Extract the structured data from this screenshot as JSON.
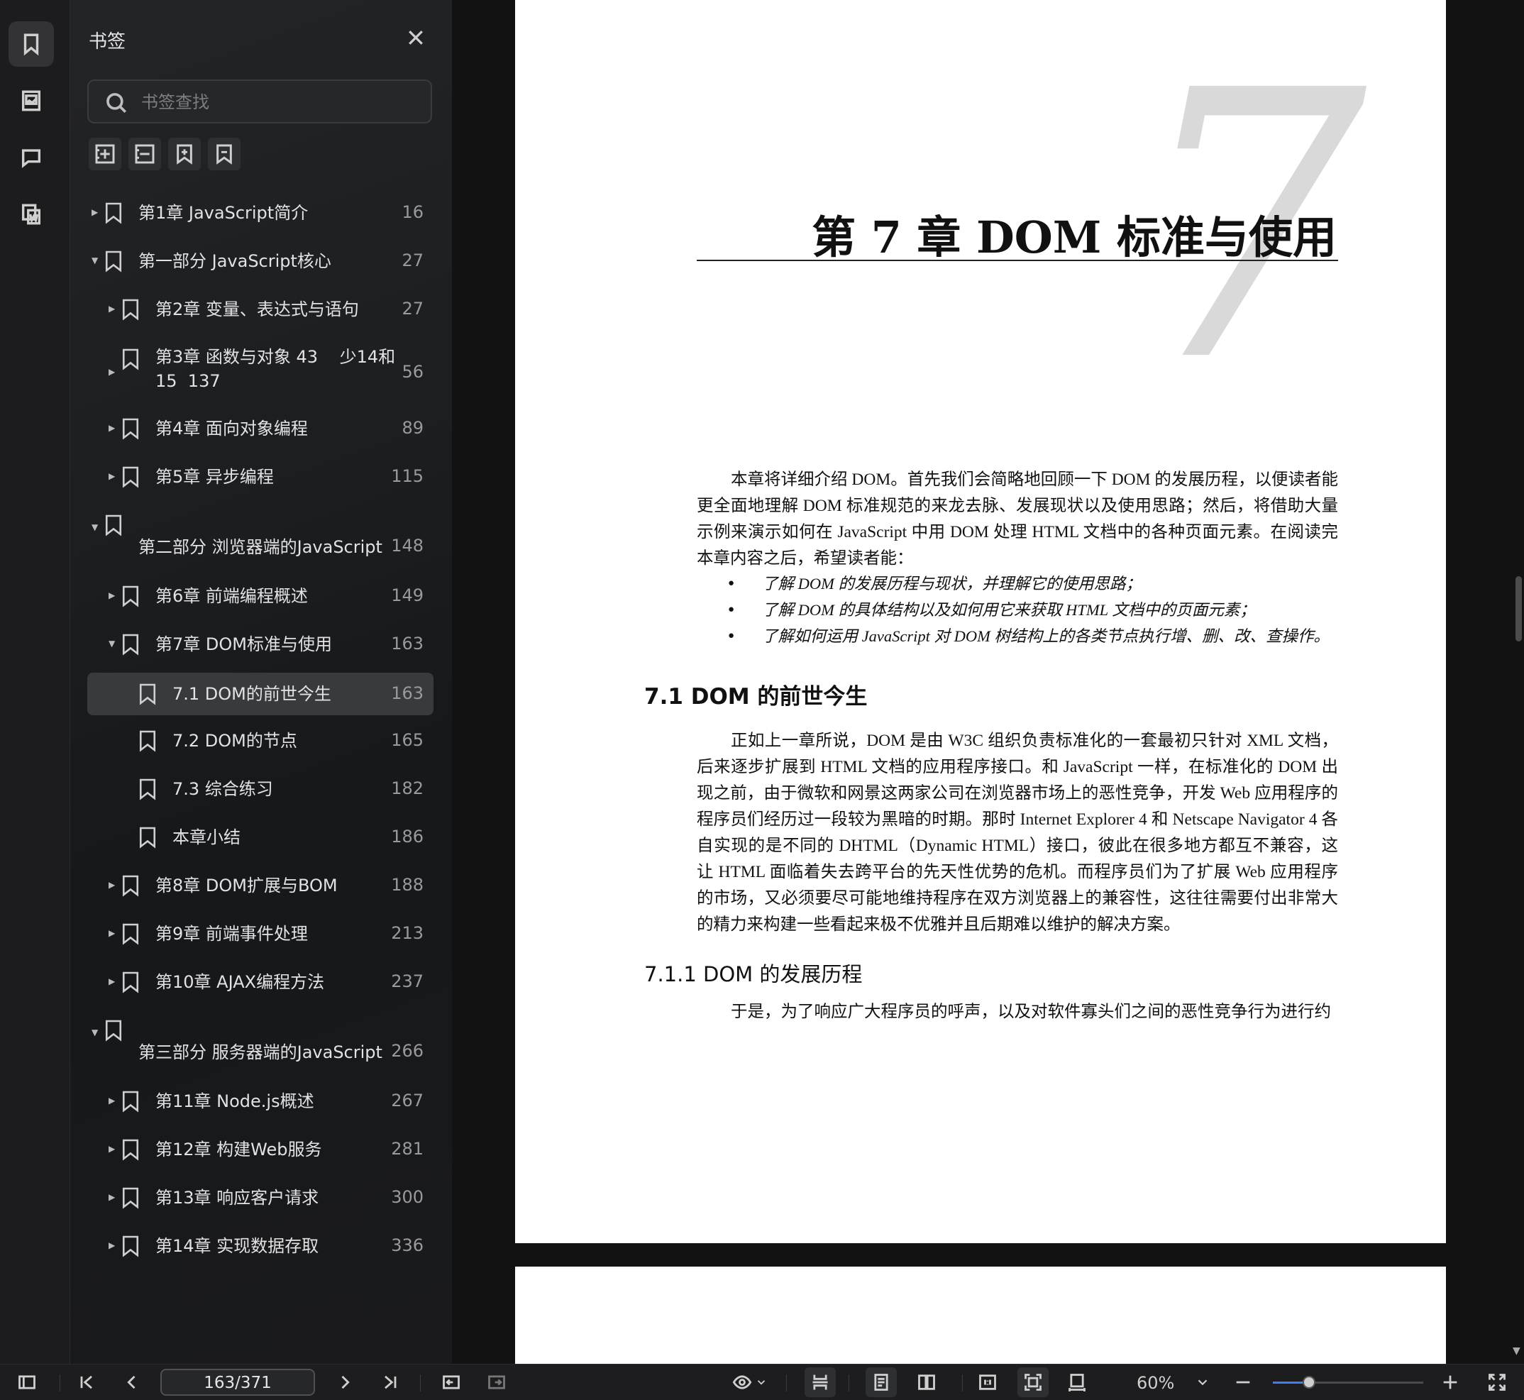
{
  "panel": {
    "title": "书签",
    "search_placeholder": "书签查找"
  },
  "bookmarks": [
    {
      "label": "第1章 JavaScript简介",
      "page": "16",
      "level": 0,
      "caret": "right"
    },
    {
      "label": "第一部分 JavaScript核心",
      "page": "27",
      "level": 0,
      "caret": "down"
    },
    {
      "label": "第2章 变量、表达式与语句",
      "page": "27",
      "level": 1,
      "caret": "right"
    },
    {
      "label": "第3章 函数与对象 43    少14和\n15  137",
      "page": "56",
      "level": 1,
      "caret": "right"
    },
    {
      "label": "第4章 面向对象编程",
      "page": "89",
      "level": 1,
      "caret": "right"
    },
    {
      "label": "第5章 异步编程",
      "page": "115",
      "level": 1,
      "caret": "right"
    },
    {
      "label": "第二部分 浏览器端的JavaScript",
      "page": "148",
      "level": 0,
      "caret": "down"
    },
    {
      "label": "第6章 前端编程概述",
      "page": "149",
      "level": 1,
      "caret": "right"
    },
    {
      "label": "第7章 DOM标准与使用",
      "page": "163",
      "level": 1,
      "caret": "down"
    },
    {
      "label": "7.1 DOM的前世今生",
      "page": "163",
      "level": 2,
      "caret": "",
      "selected": true
    },
    {
      "label": "7.2 DOM的节点",
      "page": "165",
      "level": 2,
      "caret": ""
    },
    {
      "label": "7.3 综合练习",
      "page": "182",
      "level": 2,
      "caret": ""
    },
    {
      "label": "本章小结",
      "page": "186",
      "level": 2,
      "caret": ""
    },
    {
      "label": "第8章 DOM扩展与BOM",
      "page": "188",
      "level": 1,
      "caret": "right"
    },
    {
      "label": "第9章 前端事件处理",
      "page": "213",
      "level": 1,
      "caret": "right"
    },
    {
      "label": "第10章 AJAX编程方法",
      "page": "237",
      "level": 1,
      "caret": "right"
    },
    {
      "label": "第三部分 服务器端的JavaScript",
      "page": "266",
      "level": 0,
      "caret": "down"
    },
    {
      "label": "第11章 Node.js概述",
      "page": "267",
      "level": 1,
      "caret": "right"
    },
    {
      "label": "第12章 构建Web服务",
      "page": "281",
      "level": 1,
      "caret": "right"
    },
    {
      "label": "第13章 响应客户请求",
      "page": "300",
      "level": 1,
      "caret": "right"
    },
    {
      "label": "第14章 实现数据存取",
      "page": "336",
      "level": 1,
      "caret": "right"
    }
  ],
  "document": {
    "chapter_number": "7",
    "chapter_title": "第 7 章    DOM 标准与使用",
    "intro": "本章将详细介绍 DOM。首先我们会简略地回顾一下 DOM 的发展历程，以便读者能更全面地理解 DOM 标准规范的来龙去脉、发展现状以及使用思路；然后，将借助大量示例来演示如何在 JavaScript 中用 DOM 处理 HTML 文档中的各种页面元素。在阅读完本章内容之后，希望读者能：",
    "bullets": [
      "了解 DOM 的发展历程与现状，并理解它的使用思路；",
      "了解 DOM 的具体结构以及如何用它来获取 HTML 文档中的页面元素；",
      "了解如何运用 JavaScript 对 DOM 树结构上的各类节点执行增、删、改、查操作。"
    ],
    "section_heading": "7.1    DOM 的前世今生",
    "section_para": "正如上一章所说，DOM 是由 W3C 组织负责标准化的一套最初只针对 XML 文档，后来逐步扩展到 HTML 文档的应用程序接口。和 JavaScript 一样，在标准化的 DOM 出现之前，由于微软和网景这两家公司在浏览器市场上的恶性竞争，开发 Web 应用程序的程序员们经历过一段较为黑暗的时期。那时 Internet Explorer 4 和 Netscape Navigator 4 各自实现的是不同的 DHTML（Dynamic HTML）接口，彼此在很多地方都互不兼容，这让 HTML 面临着失去跨平台的先天性优势的危机。而程序员们为了扩展 Web 应用程序的市场，又必须要尽可能地维持程序在双方浏览器上的兼容性，这往往需要付出非常大的精力来构建一些看起来极不优雅并且后期难以维护的解决方案。",
    "subsection_heading": "7.1.1    DOM 的发展历程",
    "subsection_para": "于是，为了响应广大程序员的呼声，以及对软件寡头们之间的恶性竞争行为进行约"
  },
  "toolbar": {
    "page_indicator": "163/371",
    "zoom": "60%",
    "zoom_fraction": 0.24
  }
}
